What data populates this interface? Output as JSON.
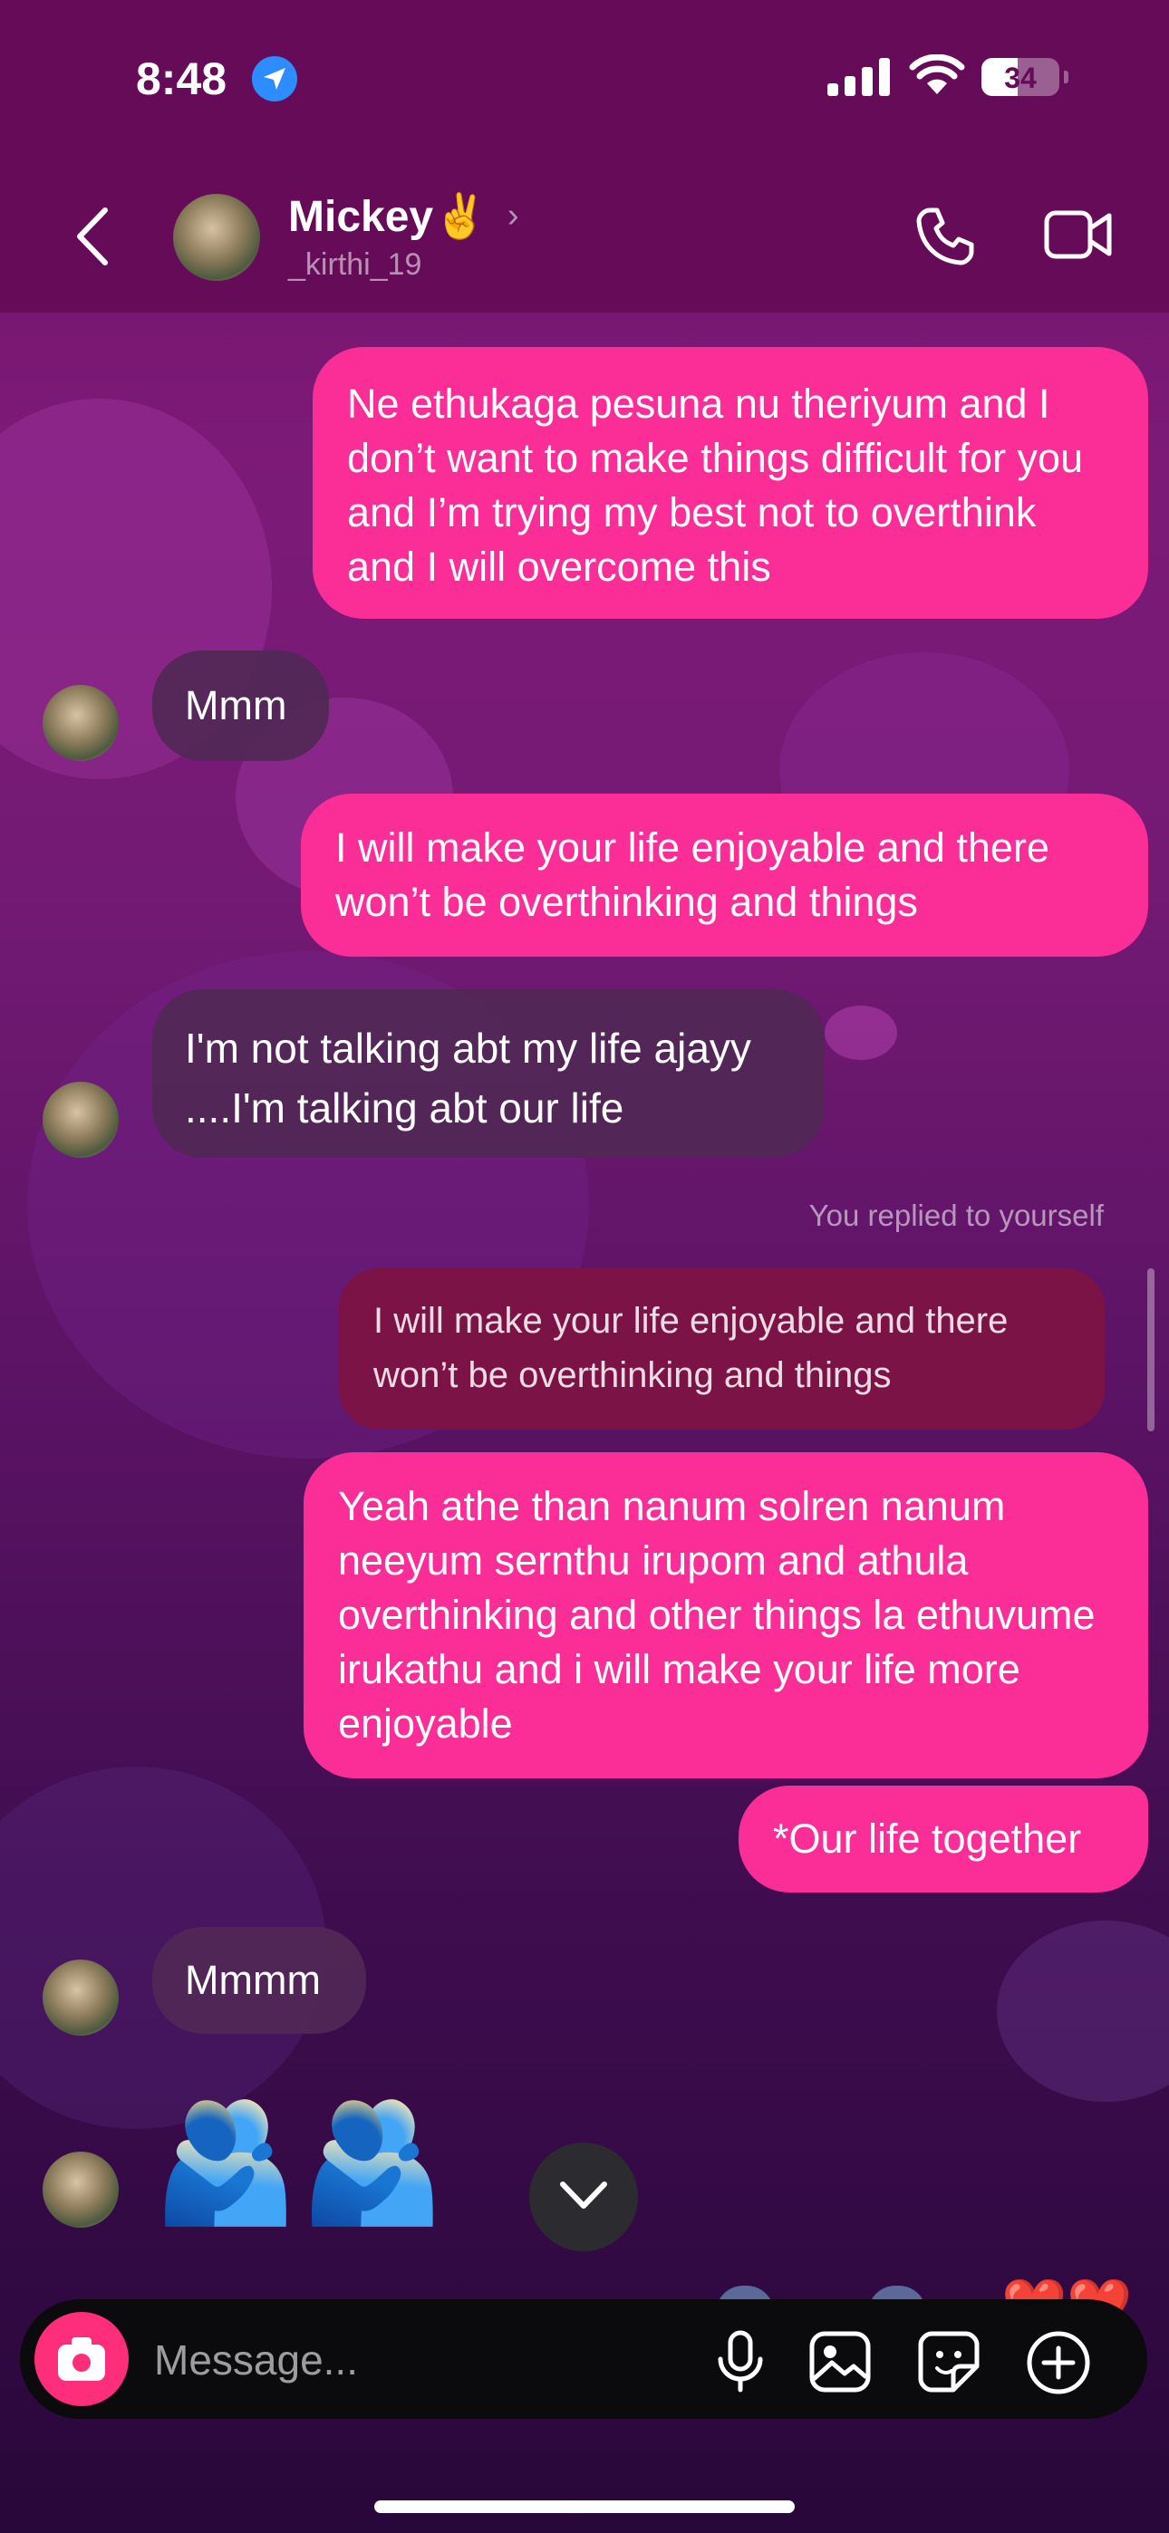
{
  "status_bar": {
    "time": "8:48",
    "battery": "34"
  },
  "header": {
    "name": "Mickey✌️",
    "username": "_kirthi_19"
  },
  "messages": [
    {
      "direction": "out",
      "text": "Ne ethukaga pesuna nu theriyum and I don’t want to make things difficult for you and I’m trying my best not to overthink and I will overcome this"
    },
    {
      "direction": "in",
      "text": "Mmm"
    },
    {
      "direction": "out",
      "text": "I will make your life enjoyable and there won’t be overthinking and things"
    },
    {
      "direction": "in",
      "text": "I'm not talking abt my life ajayy ....I'm talking abt our life"
    },
    {
      "direction": "out",
      "reply_label": "You replied to yourself",
      "quoted": "I will make your life enjoyable and there won’t be overthinking and things",
      "text": "Yeah athe than nanum solren nanum neeyum sernthu irupom and athula overthinking and other things la ethuvume irukathu and i will make your life more enjoyable"
    },
    {
      "direction": "out",
      "text": "*Our life together"
    },
    {
      "direction": "in",
      "text": "Mmmm"
    },
    {
      "direction": "in",
      "text": "🫂🫂"
    }
  ],
  "composer": {
    "placeholder": "Message..."
  },
  "peek": {
    "hearts": "❤️❤️"
  },
  "colors": {
    "outgoing_bubble": "#fb2d97",
    "incoming_bubble": "#50285a",
    "header": "#650b58",
    "camera_button": "#fe2e7b"
  }
}
